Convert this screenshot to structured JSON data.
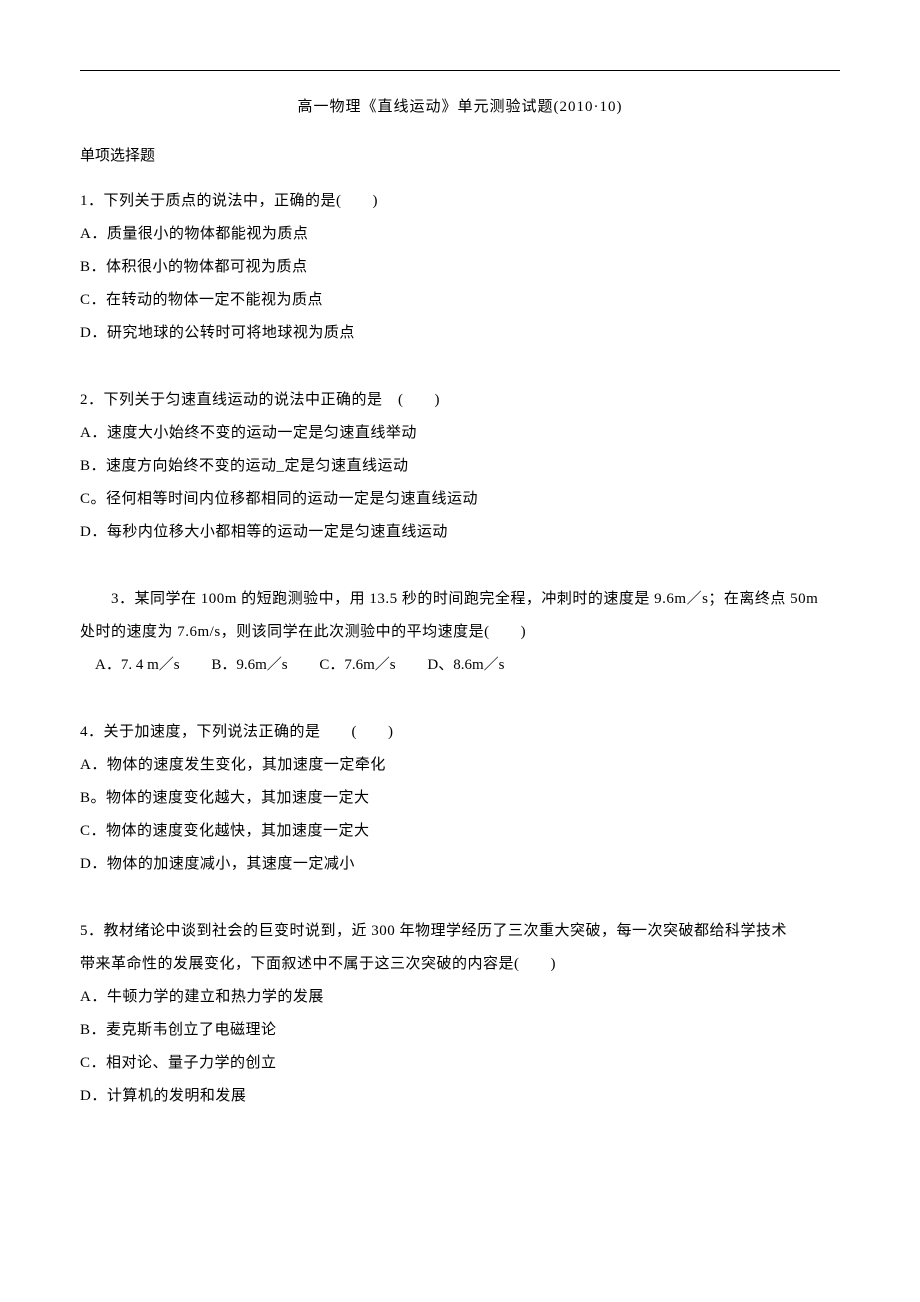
{
  "doc": {
    "title": "高一物理《直线运动》单元测验试题(2010·10)",
    "section_heading": "单项选择题",
    "questions": [
      {
        "stem": "1．下列关于质点的说法中，正确的是(　　)",
        "opts": [
          "A．质量很小的物体都能视为质点",
          "B．体积很小的物体都可视为质点",
          "C．在转动的物体一定不能视为质点",
          "D．研究地球的公转时可将地球视为质点"
        ]
      },
      {
        "stem": "2．下列关于匀速直线运动的说法中正确的是　(　　)",
        "opts": [
          "A．速度大小始终不变的运动一定是匀速直线举动",
          "B．速度方向始终不变的运动_定是匀速直线运动",
          "C。径何相等时间内位移都相同的运动一定是匀速直线运动",
          "D．每秒内位移大小都相等的运动一定是匀速直线运动"
        ]
      },
      {
        "stem_lines": [
          "　　3．某同学在 100m 的短跑测验中，用 13.5 秒的时间跑完全程，冲刺时的速度是 9.6m／s；在离终点 50m",
          "处时的速度为 7.6m/s，则该同学在此次测验中的平均速度是(　　)"
        ],
        "inline_opts": [
          "　A．7. 4 m／s",
          "B．9.6m／s",
          "C．7.6m／s",
          "D、8.6m／s"
        ]
      },
      {
        "stem": "4．关于加速度，下列说法正确的是　　(　　)",
        "opts": [
          "A．物体的速度发生变化，其加速度一定牵化",
          "B。物体的速度变化越大，其加速度一定大",
          "C．物体的速度变化越快，其加速度一定大",
          "D．物体的加速度减小，其速度一定减小"
        ]
      },
      {
        "stem_lines": [
          "5．教材绪论中谈到社会的巨变时说到，近 300 年物理学经历了三次重大突破，每一次突破都给科学技术",
          "带来革命性的发展变化，下面叙述中不属于这三次突破的内容是(　　)"
        ],
        "opts": [
          "A．牛顿力学的建立和热力学的发展",
          "B．麦克斯韦创立了电磁理论",
          "C．相对论、量子力学的创立",
          "D．计算机的发明和发展"
        ]
      }
    ]
  }
}
